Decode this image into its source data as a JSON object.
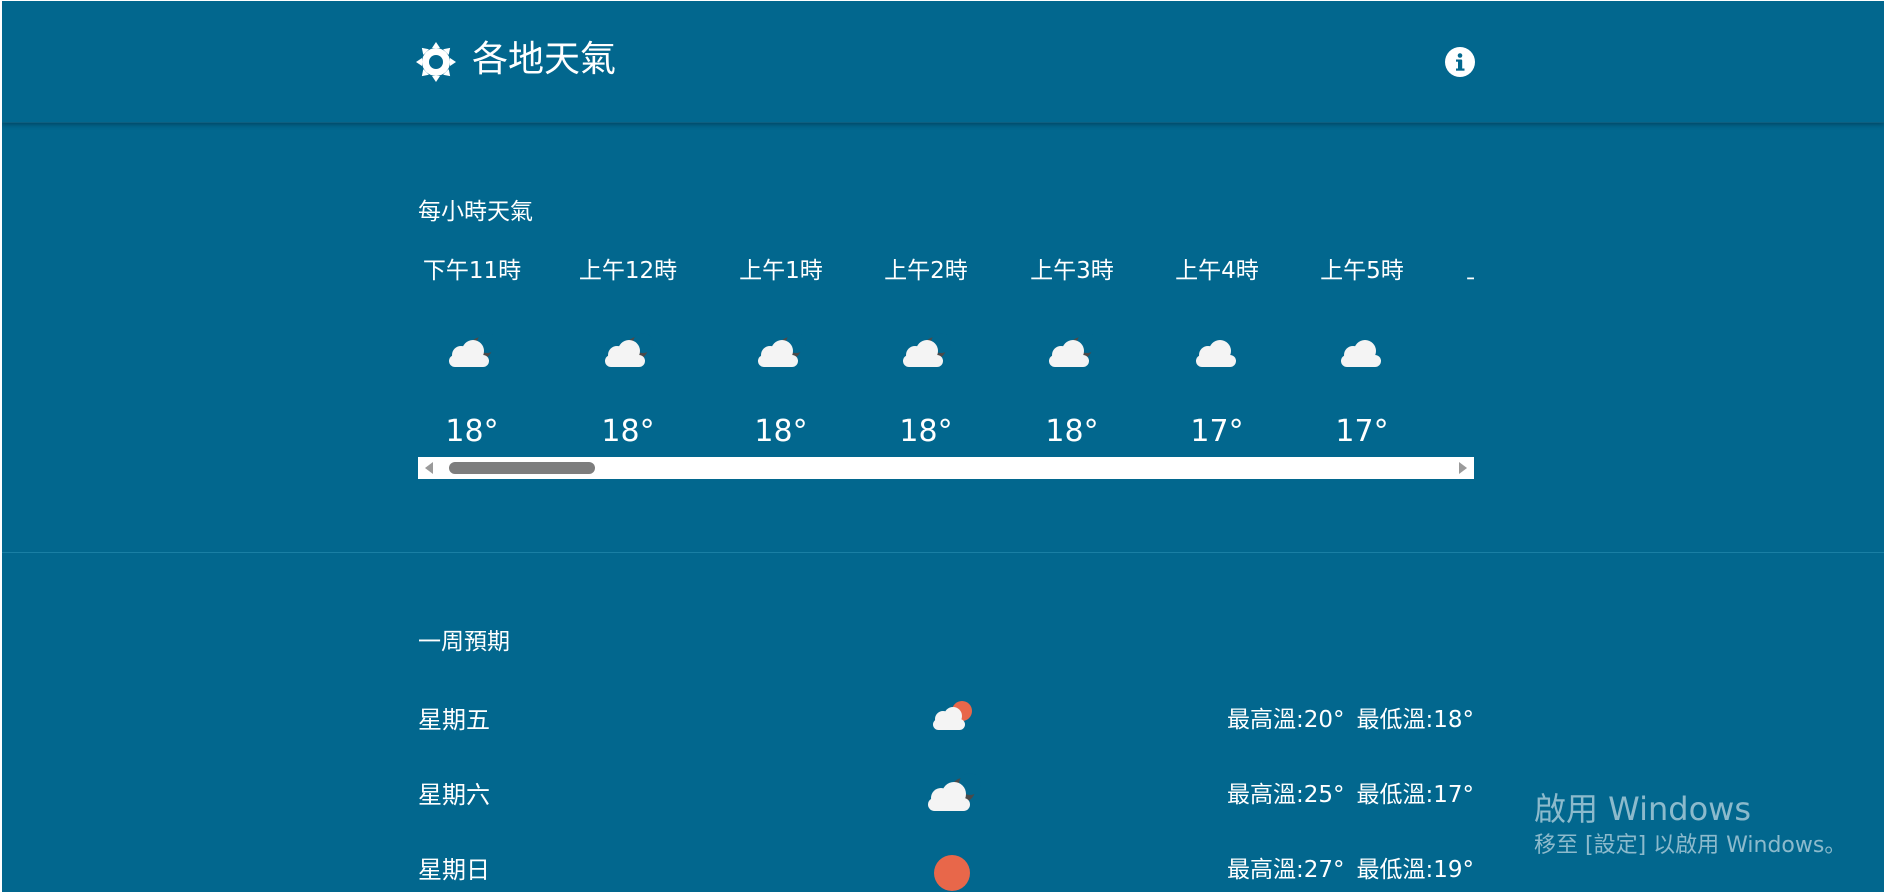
{
  "header": {
    "title": "各地天氣",
    "brand_icon": "sun-icon",
    "info_icon": "info-icon"
  },
  "hourly": {
    "title": "每小時天氣",
    "items": [
      {
        "time": "下午11時",
        "icon": "cloudy-night-icon",
        "temp": "18°"
      },
      {
        "time": "上午12時",
        "icon": "cloudy-night-icon",
        "temp": "18°"
      },
      {
        "time": "上午1時",
        "icon": "cloudy-night-icon",
        "temp": "18°"
      },
      {
        "time": "上午2時",
        "icon": "cloudy-night-icon",
        "temp": "18°"
      },
      {
        "time": "上午3時",
        "icon": "cloudy-night-icon",
        "temp": "18°"
      },
      {
        "time": "上午4時",
        "icon": "cloud-icon",
        "temp": "17°"
      },
      {
        "time": "上午5時",
        "icon": "cloud-icon",
        "temp": "17°"
      },
      {
        "time": "上",
        "icon": "",
        "temp": ""
      }
    ],
    "scroll_position": 0.1
  },
  "weekly": {
    "title": "一周預期",
    "days": [
      {
        "day": "星期五",
        "icon": "partly-sunny-icon",
        "high": "最高溫:20°",
        "low": "最低溫:18°"
      },
      {
        "day": "星期六",
        "icon": "cloudy-night-icon",
        "high": "最高溫:25°",
        "low": "最低溫:17°"
      },
      {
        "day": "星期日",
        "icon": "sun-icon",
        "high": "最高溫:27°",
        "low": "最低溫:19°"
      }
    ]
  },
  "watermark": {
    "title": "啟用 Windows",
    "subtitle": "移至 [設定] 以啟用 Windows。"
  },
  "colors": {
    "background": "#02678e",
    "sun": "#e8674a",
    "cloud": "#f4f4f4",
    "moon": "#4a4a4a",
    "scrollbar_thumb": "#7d7d7d"
  }
}
